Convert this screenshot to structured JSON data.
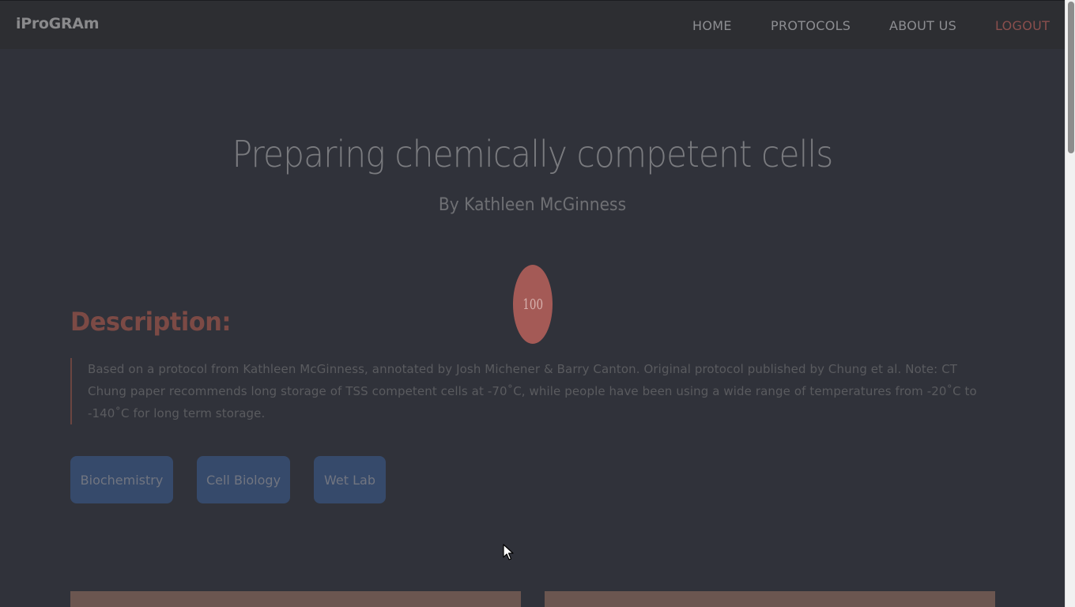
{
  "navbar": {
    "brand": "iProGRAm",
    "links": [
      {
        "label": "HOME"
      },
      {
        "label": "PROTOCOLS"
      },
      {
        "label": "ABOUT US"
      },
      {
        "label": "LOGOUT"
      }
    ]
  },
  "protocol": {
    "title": "Preparing chemically competent cells",
    "author": "By Kathleen McGinness",
    "score": "100",
    "description_heading": "Description:",
    "description": "Based on a protocol from Kathleen McGinness, annotated by Josh Michener & Barry Canton. Original protocol published by Chung et al. Note: CT Chung paper recommends long storage of TSS competent cells at -70˚C, while people have been using a wide range of temperatures from -20˚C to -140˚C for long term storage.",
    "tags": [
      {
        "label": "Biochemistry"
      },
      {
        "label": "Cell Biology"
      },
      {
        "label": "Wet Lab"
      }
    ]
  },
  "colors": {
    "background": "#30323a",
    "navbar": "#2d2e32",
    "accent_red": "#a45a56",
    "tag_blue": "#364a6b",
    "card_brown": "#6b5650"
  }
}
